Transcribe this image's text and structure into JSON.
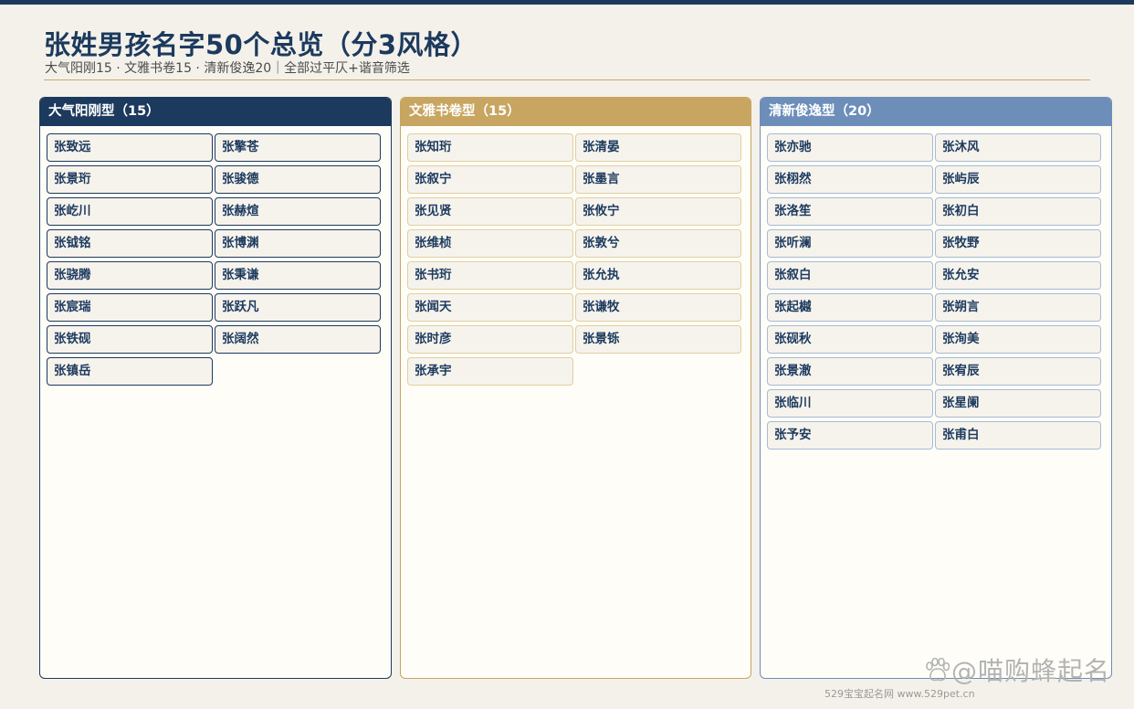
{
  "header": {
    "title": "张姓男孩名字50个总览（分3风格）",
    "subtitle": "大气阳刚15 · 文雅书卷15 · 清新俊逸20｜全部过平仄+谐音筛选"
  },
  "colors": {
    "navy": "#1c3a5e",
    "gold": "#c8a560",
    "blue": "#6c8eb9",
    "background": "#f4f1ea"
  },
  "groups": [
    {
      "title": "大气阳刚型（15）",
      "names": [
        "张致远",
        "张擎苍",
        "张景珩",
        "张骏德",
        "张屹川",
        "张赫煊",
        "张钺铭",
        "张博渊",
        "张骁腾",
        "张秉谦",
        "张宸瑞",
        "张跃凡",
        "张铁砚",
        "张阔然",
        "张镇岳"
      ]
    },
    {
      "title": "文雅书卷型（15）",
      "names": [
        "张知珩",
        "张清晏",
        "张叙宁",
        "张墨言",
        "张见贤",
        "张攸宁",
        "张维桢",
        "张敦兮",
        "张书珩",
        "张允执",
        "张闻天",
        "张谦牧",
        "张时彦",
        "张景铄",
        "张承宇"
      ]
    },
    {
      "title": "清新俊逸型（20）",
      "names": [
        "张亦驰",
        "张沐风",
        "张栩然",
        "张屿辰",
        "张洛笙",
        "张初白",
        "张听澜",
        "张牧野",
        "张叙白",
        "张允安",
        "张起樾",
        "张朔言",
        "张砚秋",
        "张洵美",
        "张景澈",
        "张宥辰",
        "张临川",
        "张星阑",
        "张予安",
        "张甫白"
      ]
    }
  ],
  "watermark": {
    "text": "@喵购蜂起名",
    "icon": "paw-icon"
  },
  "footer": {
    "text": "529宝宝起名网  www.529pet.cn"
  }
}
